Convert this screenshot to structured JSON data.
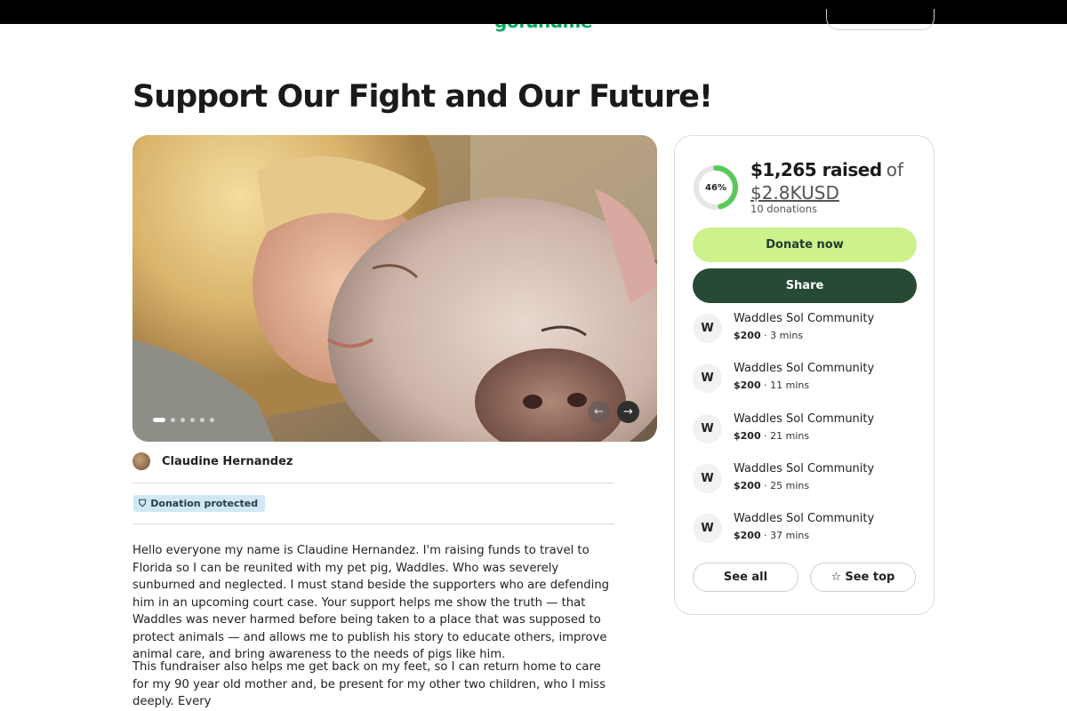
{
  "header": {
    "logo": "gofundme"
  },
  "campaign": {
    "title": "Support Our Fight and Our Future!",
    "organizer": "Claudine Hernandez",
    "protection_badge": "Donation protected",
    "story": [
      "Hello everyone my name is Claudine Hernandez. I'm raising funds to travel to Florida so I can be reunited with my pet pig, Waddles. Who was severely sunburned and neglected. I must stand beside the supporters who are defending him in an upcoming court case. Your support helps me show the truth — that Waddles was never harmed before being taken to a place that was supposed to protect animals — and allows me to publish his story to educate others, improve animal care, and bring awareness to the needs of pigs like him.",
      "This fundraiser also helps me get back on my feet, so I can return home to care for my 90 year old mother and, be present for my other two children, who I miss deeply. Every"
    ],
    "carousel": {
      "slides": 6,
      "active": 0,
      "prev_icon": "arrow-left-icon",
      "next_icon": "arrow-right-icon"
    }
  },
  "donation_card": {
    "progress_percent": 46,
    "progress_label": "46%",
    "raised": "$1,265 raised",
    "of_label": "of",
    "goal": "$2.8KUSD",
    "donation_count": "10 donations",
    "donate_label": "Donate now",
    "share_label": "Share",
    "donors": [
      {
        "initial": "W",
        "name": "Waddles Sol Community",
        "amount": "$200",
        "time": "3 mins"
      },
      {
        "initial": "W",
        "name": "Waddles Sol Community",
        "amount": "$200",
        "time": "11 mins"
      },
      {
        "initial": "W",
        "name": "Waddles Sol Community",
        "amount": "$200",
        "time": "21 mins"
      },
      {
        "initial": "W",
        "name": "Waddles Sol Community",
        "amount": "$200",
        "time": "25 mins"
      },
      {
        "initial": "W",
        "name": "Waddles Sol Community",
        "amount": "$200",
        "time": "37 mins"
      }
    ],
    "see_all_label": "See all",
    "see_top_label": "See top"
  },
  "colors": {
    "brand": "#02a95c",
    "donate_button": "#cdf18b",
    "share_button": "#264a33",
    "progress_ring": "#5cc85c",
    "badge_bg": "#cfe8f3"
  }
}
